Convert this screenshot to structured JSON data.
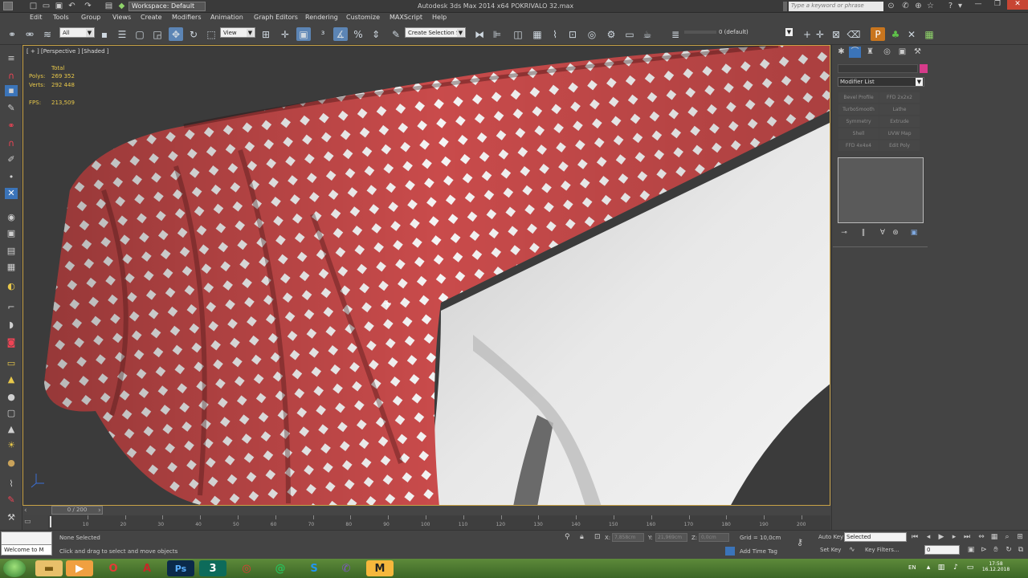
{
  "title_bar": {
    "workspace": "Workspace: Default",
    "app_title": "Autodesk 3ds Max 2014 x64    POKRIVALO 32.max",
    "search_placeholder": "Type a keyword or phrase"
  },
  "menu": [
    "Edit",
    "Tools",
    "Group",
    "Views",
    "Create",
    "Modifiers",
    "Animation",
    "Graph Editors",
    "Rendering",
    "Customize",
    "MAXScript",
    "Help"
  ],
  "toolbar": {
    "selection_filter": "All",
    "ref_coord": "View",
    "named_selection": "Create Selection Se",
    "layer": "0 (default)"
  },
  "viewport": {
    "label": "[ + ] [Perspective ] [Shaded ]",
    "stats": {
      "total_label": "Total",
      "polys_label": "Polys:",
      "polys": "269 352",
      "verts_label": "Verts:",
      "verts": "292 448",
      "fps_label": "FPS:",
      "fps": "213,509"
    },
    "cloth_color": "#c94b4b",
    "table_color": "#d9d9d9"
  },
  "command_panel": {
    "modifier_list": "Modifier List",
    "modifiers": [
      "Bevel Profile",
      "FFD 2x2x2",
      "TurboSmooth",
      "Lathe",
      "Symmetry",
      "Extrude",
      "Shell",
      "UVW Map",
      "FFD 4x4x4",
      "Edit Poly"
    ],
    "object_color": "#d63b8a"
  },
  "timeline": {
    "frame_display": "0 / 200",
    "ticks": [
      "10",
      "20",
      "30",
      "40",
      "50",
      "60",
      "70",
      "80",
      "90",
      "100",
      "110",
      "120",
      "130",
      "140",
      "150",
      "160",
      "170",
      "180",
      "190",
      "200"
    ]
  },
  "status": {
    "maxscript_listener": "Welcome to M",
    "selection": "None Selected",
    "prompt": "Click and drag to select and move objects",
    "x_label": "X:",
    "x_value": "7,858cm",
    "y_label": "Y:",
    "y_value": "21,969cm",
    "z_label": "Z:",
    "z_value": "0,0cm",
    "grid": "Grid = 10,0cm",
    "add_time_tag": "Add Time Tag",
    "auto_key": "Auto Key",
    "auto_key_mode": "Selected",
    "set_key": "Set Key",
    "key_filters": "Key Filters...",
    "current_frame": "0"
  },
  "taskbar": {
    "language": "EN",
    "time": "17:58",
    "date": "16.12.2018",
    "apps": [
      "folder",
      "media",
      "opera",
      "acrobat",
      "photoshop",
      "3dsmax",
      "chrome",
      "messenger",
      "skype",
      "viber",
      "gmail"
    ]
  }
}
